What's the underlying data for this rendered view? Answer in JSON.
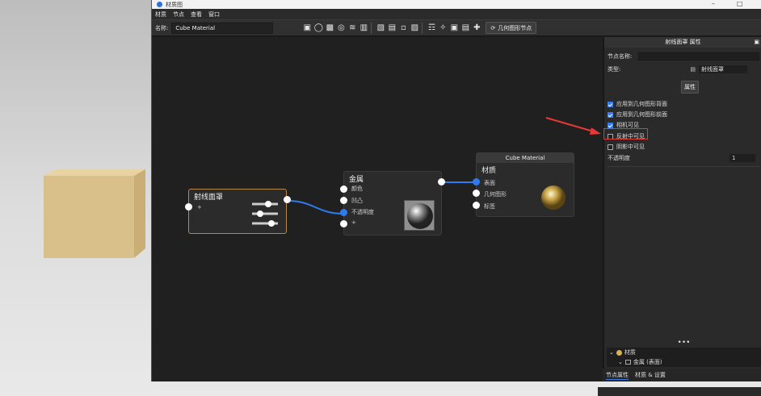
{
  "window": {
    "title": "材质图",
    "minimize_glyph": "–",
    "maximize_glyph": "□"
  },
  "menu": [
    "材质",
    "节点",
    "查看",
    "窗口"
  ],
  "toolbar": {
    "name_label": "名称:",
    "name_value": "Cube Material",
    "graph_node_button": "几何图形节点"
  },
  "nodes": {
    "ray_cover": {
      "title": "射线面罩",
      "port_plus": "+"
    },
    "metal": {
      "title": "金属",
      "ports": [
        "颜色",
        "凹凸",
        "不透明度",
        "+"
      ]
    },
    "material": {
      "header": "Cube Material",
      "title": "材质",
      "ports": [
        "表面",
        "几何图形",
        "标签"
      ]
    }
  },
  "panel": {
    "header": "射线面罩 属性",
    "node_name_label": "节点名称:",
    "type_label": "类型:",
    "type_value": "射线面罩",
    "props_button": "属性",
    "checkboxes": [
      {
        "label": "应用到几何图形背面",
        "checked": true
      },
      {
        "label": "应用到几何图形前面",
        "checked": true
      },
      {
        "label": "相机可见",
        "checked": true
      },
      {
        "label": "反射中可见",
        "checked": false
      },
      {
        "label": "阴影中可见",
        "checked": false
      }
    ],
    "opacity_label": "不透明度",
    "opacity_value": "1",
    "dots": "•••",
    "tree": [
      {
        "label": "材质"
      },
      {
        "label": "金属 (表面)"
      }
    ],
    "tabs": [
      "节点属性",
      "材质 & 设置"
    ]
  },
  "colors": {
    "accent": "#2e7bf0",
    "highlight": "#e53935",
    "arrow": "#e53935"
  }
}
